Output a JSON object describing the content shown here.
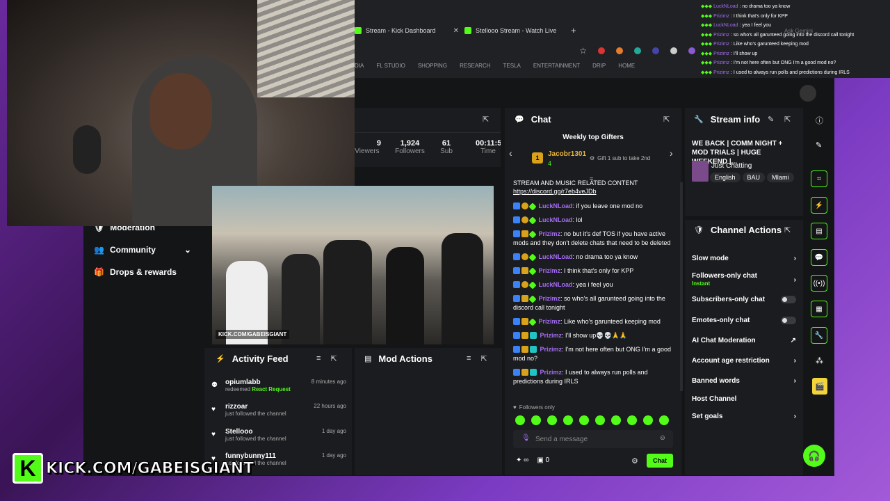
{
  "browser": {
    "tabs": [
      {
        "label": "Stream - Kick Dashboard"
      },
      {
        "label": "Stellooo Stream - Watch Live"
      }
    ],
    "ask_gemini": "Ask Gemini",
    "bookmarks": [
      "DIA",
      "FL STUDIO",
      "SHOPPING",
      "RESEARCH",
      "TESLA",
      "ENTERTAINMENT",
      "DRIP",
      "HOME"
    ]
  },
  "overlay_chat": [
    {
      "name": "LuckNLoad",
      "text": "no drama too ya know"
    },
    {
      "name": "Prizimz",
      "text": "I think that's only for KPP"
    },
    {
      "name": "LuckNLoad",
      "text": "yea I feel you"
    },
    {
      "name": "Prizimz",
      "text": "so who's all garunteed going into the discord call tonight"
    },
    {
      "name": "Prizimz",
      "text": "Like who's garunteed keeping mod"
    },
    {
      "name": "Prizimz",
      "text": "I'll show up"
    },
    {
      "name": "Prizimz",
      "text": "I'm not here often but ONG I'm a good mod no?"
    },
    {
      "name": "Prizimz",
      "text": "I used to always run polls and predictions during IRLS"
    }
  ],
  "sidebar": {
    "moderation": "Moderation",
    "community": "Community",
    "drops": "Drops & rewards"
  },
  "stats": {
    "viewers_value": "9",
    "viewers_label": "Viewers",
    "followers_value": "1,924",
    "followers_label": "Followers",
    "subs_value": "61",
    "subs_label": "Sub",
    "time_value": "00:11:5",
    "time_label": "Time"
  },
  "video": {
    "overlay_tag": "KICK.COM/GABEISGIANT"
  },
  "chat": {
    "title": "Chat",
    "gifters_title": "Weekly top Gifters",
    "top_gifter": "Jacobr1301",
    "top_gifter_count": "4",
    "gift_prompt": "Gift 1 sub to take 2nd",
    "pinned_text": "STREAM AND MUSIC RELATED CONTENT",
    "pinned_link": "https://discord.gg/r7eb4veJDb",
    "messages": [
      {
        "name": "LuckNLoad",
        "text": "if you leave one mod no"
      },
      {
        "name": "LuckNLoad",
        "text": "lol"
      },
      {
        "name": "Prizimz",
        "text": "no but it's def TOS if you have active mods and they don't delete chats that need to be deleted"
      },
      {
        "name": "LuckNLoad",
        "text": "no drama too ya know"
      },
      {
        "name": "Prizimz",
        "text": "I think that's only for KPP"
      },
      {
        "name": "LuckNLoad",
        "text": "yea i feel you"
      },
      {
        "name": "Prizimz",
        "text": "so who's all garunteed going into the discord call tonight"
      },
      {
        "name": "Prizimz",
        "text": "Like who's garunteed keeping mod"
      },
      {
        "name": "Prizimz",
        "text": "I'll show up💀💀🙏🙏"
      },
      {
        "name": "Prizimz",
        "text": "I'm not here often but ONG I'm a good mod no?"
      },
      {
        "name": "Prizimz",
        "text": "I used to always run polls and predictions during IRLS"
      }
    ],
    "followers_only": "Followers only",
    "input_placeholder": "Send a message",
    "infinity": "∞",
    "gift_count": "0",
    "send_label": "Chat"
  },
  "stream_info": {
    "title": "Stream info",
    "stream_title": "WE BACK | COMM NIGHT + MOD TRIALS | HUGE WEEKEND |...",
    "category": "Just Chatting",
    "tags": [
      "English",
      "BAU",
      "MIami"
    ]
  },
  "channel_actions": {
    "title": "Channel Actions",
    "items": [
      {
        "label": "Slow mode"
      },
      {
        "label": "Followers-only chat",
        "sub": "Instant"
      },
      {
        "label": "Subscribers-only chat"
      },
      {
        "label": "Emotes-only chat"
      },
      {
        "label": "AI Chat Moderation"
      },
      {
        "label": "Account age restriction"
      },
      {
        "label": "Banned words"
      },
      {
        "label": "Host Channel"
      },
      {
        "label": "Set goals"
      }
    ]
  },
  "activity_feed": {
    "title": "Activity Feed",
    "items": [
      {
        "name": "opiumlabb",
        "action": "redeemed",
        "reward": "React Request",
        "time": "8 minutes ago"
      },
      {
        "name": "rizzoar",
        "action": "just followed the channel",
        "time": "22 hours ago"
      },
      {
        "name": "Stellooo",
        "action": "just followed the channel",
        "time": "1 day ago"
      },
      {
        "name": "funnybunny111",
        "action": "just followed the channel",
        "time": "1 day ago"
      }
    ]
  },
  "mod_actions": {
    "title": "Mod Actions"
  },
  "banner": {
    "url": "KICK.COM/GABEISGIANT",
    "logo": "K"
  },
  "colors": {
    "accent": "#53fc18",
    "panel": "#1b1c1f",
    "bg": "#141517",
    "name": "#a46cf4"
  }
}
